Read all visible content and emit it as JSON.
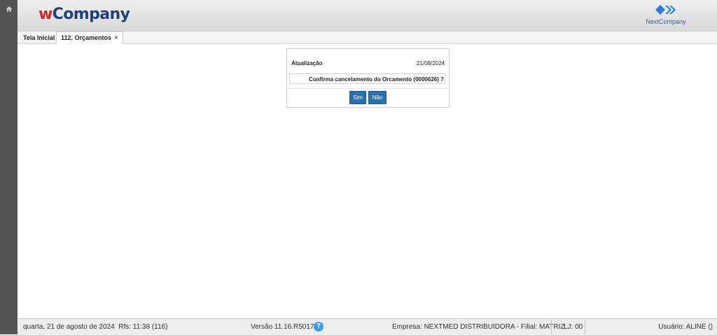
{
  "header": {
    "logo_w": "w",
    "logo_rest": "Company",
    "brand_text": "NextCompany",
    "brand_icon": "diamond-arrows-icon"
  },
  "sidebar": {
    "home_icon": "home-icon"
  },
  "tabs": [
    {
      "label": "Tela Inicial"
    },
    {
      "label": "112. Orçamentos",
      "close": "×"
    }
  ],
  "dialog": {
    "title": "Atualização",
    "date": "21/08/2024",
    "message": "Confirma cancelamento do Orcamento (0000626) ?",
    "yes_label": "Sim",
    "no_label": "Não"
  },
  "footer": {
    "date_text": "quarta, 21 de agosto de 2024  Rfs: 11:38 (116)",
    "version": "Versão 11.16.R5017",
    "help": "?",
    "empresa": "Empresa: NEXTMED DISTRIBUIDORA - Filial: MATRIZ",
    "lj": "LJ: 00",
    "usuario": "Usuário: ALINE ()"
  },
  "colors": {
    "accent": "#2a6fae",
    "logo_red": "#d4282c",
    "logo_blue": "#1f3f7a",
    "brand_blue": "#2a62b4"
  }
}
